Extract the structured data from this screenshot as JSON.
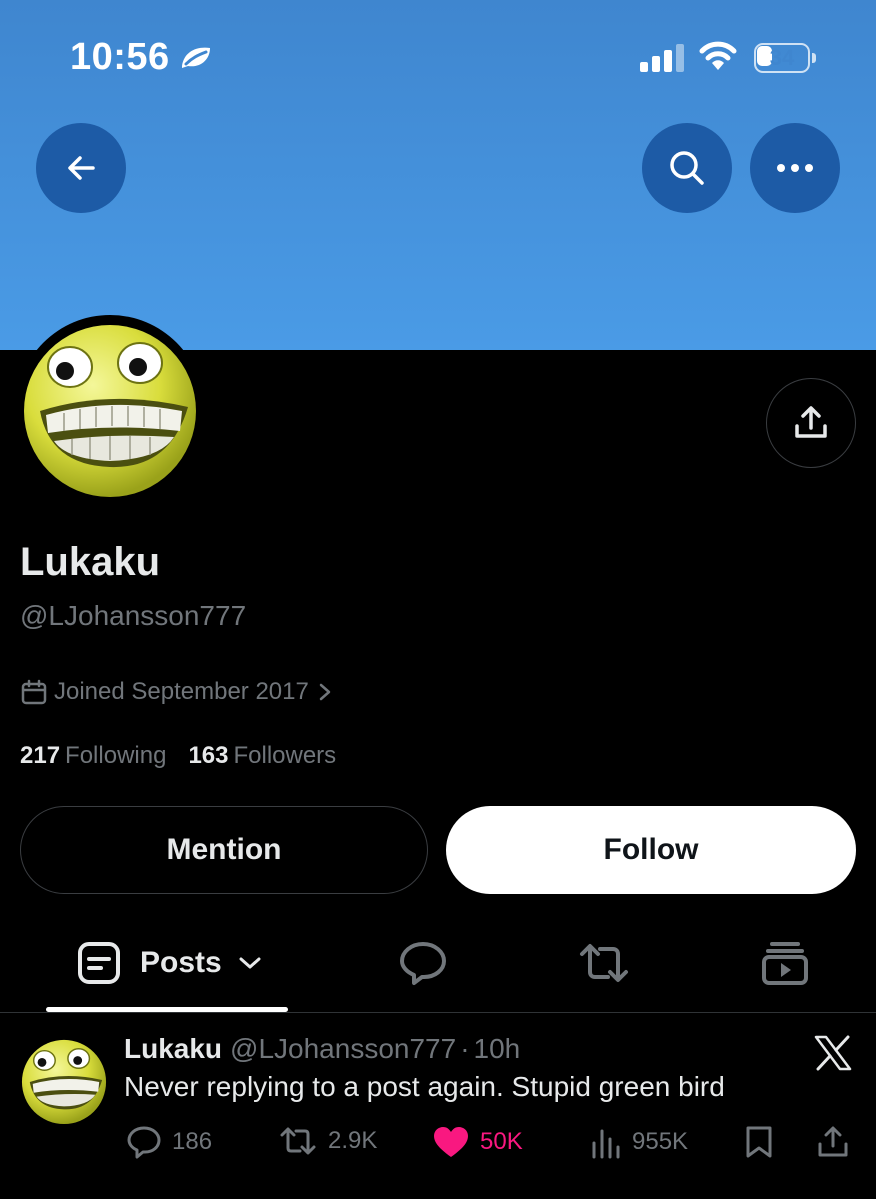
{
  "status_bar": {
    "time": "10:56",
    "battery_level": "34",
    "battery_fraction": 0.34
  },
  "profile": {
    "display_name": "Lukaku",
    "handle": "@LJohansson777",
    "joined": "Joined September 2017",
    "following_count": "217",
    "following_label": "Following",
    "followers_count": "163",
    "followers_label": "Followers",
    "banner_color": "#4a9be6",
    "avatar": "grinning-yellow-smiley-avatar"
  },
  "buttons": {
    "mention_label": "Mention",
    "follow_label": "Follow"
  },
  "tabs": {
    "posts_label": "Posts",
    "icons": [
      "posts-icon",
      "replies-icon",
      "reposts-icon",
      "media-icon"
    ]
  },
  "post": {
    "name": "Lukaku",
    "handle": "@LJohansson777",
    "separator": "·",
    "time": "10h",
    "text": "Never replying to a post again. Stupid green bird",
    "replies": "186",
    "reposts": "2.9K",
    "likes": "50K",
    "views": "955K",
    "liked": true,
    "like_color": "#f91880"
  }
}
